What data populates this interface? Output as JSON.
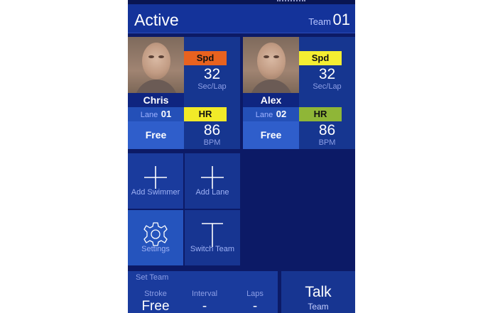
{
  "header": {
    "title": "Active",
    "team_label": "Team",
    "team_number": "01"
  },
  "swimmers": [
    {
      "name": "Chris",
      "lane_label": "Lane",
      "lane_number": "01",
      "stroke": "Free",
      "speed": {
        "tag": "Spd",
        "tag_color": "#e8621f",
        "value": "32",
        "unit": "Sec/Lap"
      },
      "heart_rate": {
        "tag": "HR",
        "tag_color": "#f1ea28",
        "value": "86",
        "unit": "BPM"
      }
    },
    {
      "name": "Alex",
      "lane_label": "Lane",
      "lane_number": "02",
      "stroke": "Free",
      "speed": {
        "tag": "Spd",
        "tag_color": "#f4ee32",
        "value": "32",
        "unit": "Sec/Lap"
      },
      "heart_rate": {
        "tag": "HR",
        "tag_color": "#8fb637",
        "value": "86",
        "unit": "BPM"
      }
    }
  ],
  "tiles": [
    {
      "label": "Add Swimmer",
      "icon": "plus-icon"
    },
    {
      "label": "Add Lane",
      "icon": "plus-icon"
    },
    {
      "label": "Settings",
      "icon": "gear-icon"
    },
    {
      "label": "Switch Team",
      "icon": "t-icon"
    }
  ],
  "set_team": {
    "title": "Set Team",
    "columns": [
      {
        "header": "Stroke",
        "value": "Free"
      },
      {
        "header": "Interval",
        "value": "-"
      },
      {
        "header": "Laps",
        "value": "-"
      }
    ]
  },
  "talk": {
    "label": "Talk",
    "sub": "Team"
  },
  "colors": {
    "background": "#0c1a66",
    "header": "#14339a",
    "tile": "#173591",
    "tile_active": "#2554bd"
  }
}
